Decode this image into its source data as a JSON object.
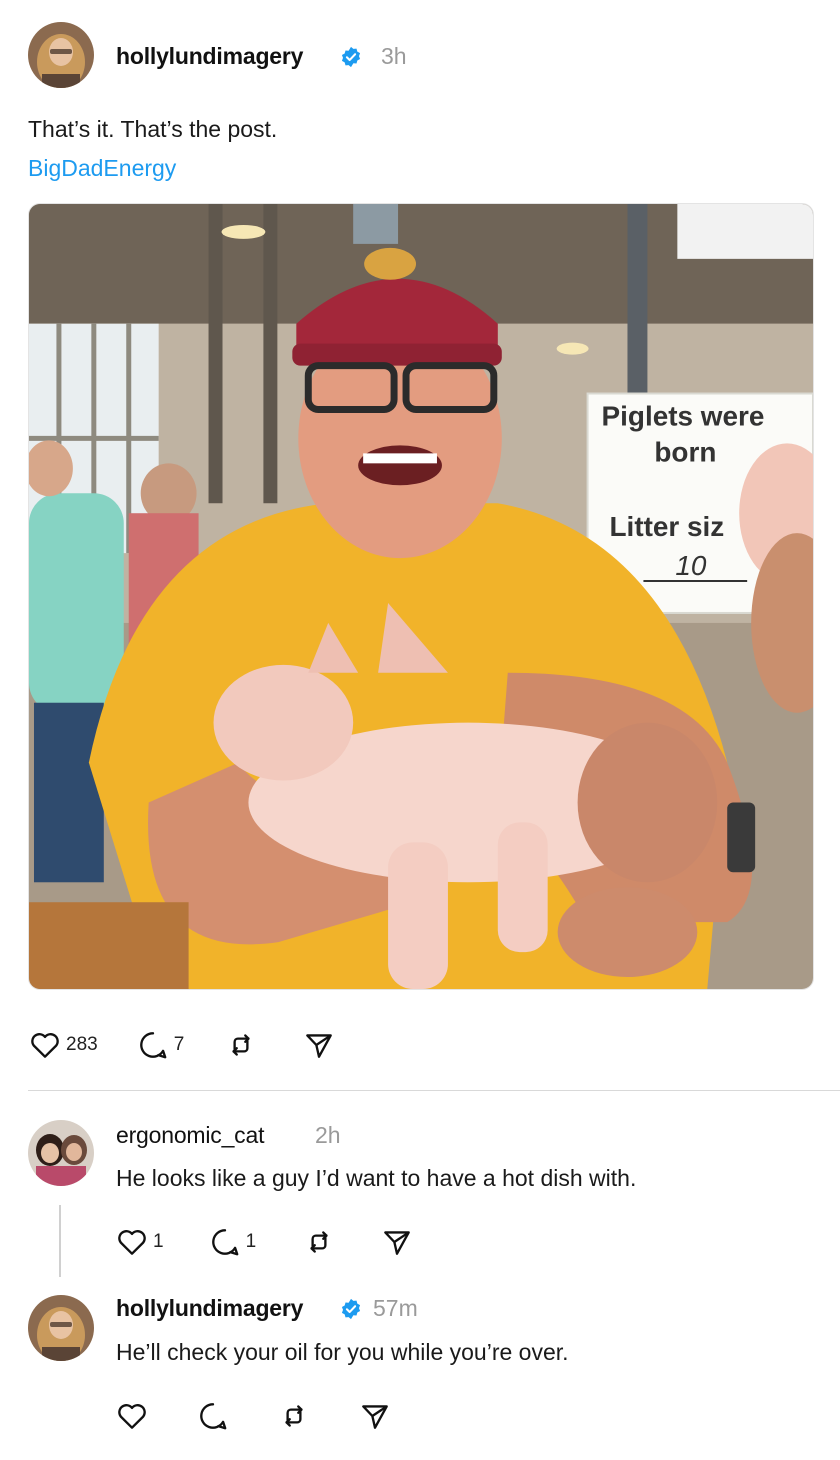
{
  "post": {
    "username": "hollylundimagery",
    "time": "3h",
    "text": "That’s it. That’s the post.",
    "tag": "BigDadEnergy",
    "image_sign": {
      "line1": "Piglets were",
      "line2": "born",
      "line3": "Litter siz",
      "line4": "10"
    },
    "likes": "283",
    "replies": "7"
  },
  "comments": [
    {
      "username": "ergonomic_cat",
      "time": "2h",
      "text": "He looks like a guy I’d want to have a hot dish with.",
      "likes": "1",
      "replies": "1"
    },
    {
      "username": "hollylundimagery",
      "time": "57m",
      "text": "He’ll check your oil for you while you’re over."
    }
  ],
  "colors": {
    "accent_link": "#1d9bf0",
    "verified_badge": "#1d9bf0",
    "muted_text": "#9a9a9a"
  },
  "icons": [
    "heart-icon",
    "comment-icon",
    "repost-icon",
    "share-icon",
    "verified-badge-icon"
  ]
}
